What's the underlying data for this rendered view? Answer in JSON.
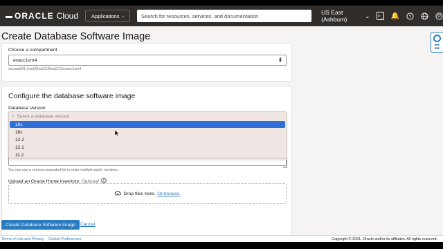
{
  "nav": {
    "logo_word": "ORACLE",
    "logo_product": "Cloud",
    "apps_label": "Applications",
    "search_placeholder": "Search for resources, services, and documentation",
    "region": "US East (Ashburn)"
  },
  "page": {
    "title": "Create Database Software Image"
  },
  "compartment": {
    "label": "Choose a compartment",
    "value": "exacc1vm4",
    "path": "oscnas001 (root)/ExaCC/ExaCC1/exacc1vm4"
  },
  "configure": {
    "title": "Configure the database software image",
    "version_label": "Database Version",
    "placeholder_option": "Select a database version",
    "options": [
      "19c",
      "18c",
      "12.2",
      "12.1",
      "11.2"
    ],
    "selected_index": 0,
    "patch_hint": "You can use a comma-separated list to enter multiple patch numbers.",
    "upload_label": "Upload an Oracle Home inventory",
    "upload_optional": "Optional",
    "drop_text": "Drop files here.",
    "browse_text": "Or browse."
  },
  "actions": {
    "create_label": "Create Database Software Image",
    "cancel_label": "Cancel"
  },
  "footer": {
    "terms": "Terms of Use and Privacy",
    "cookies": "Cookie Preferences",
    "copyright": "Copyright © 2021, Oracle and/or its affiliates. All rights reserved."
  }
}
